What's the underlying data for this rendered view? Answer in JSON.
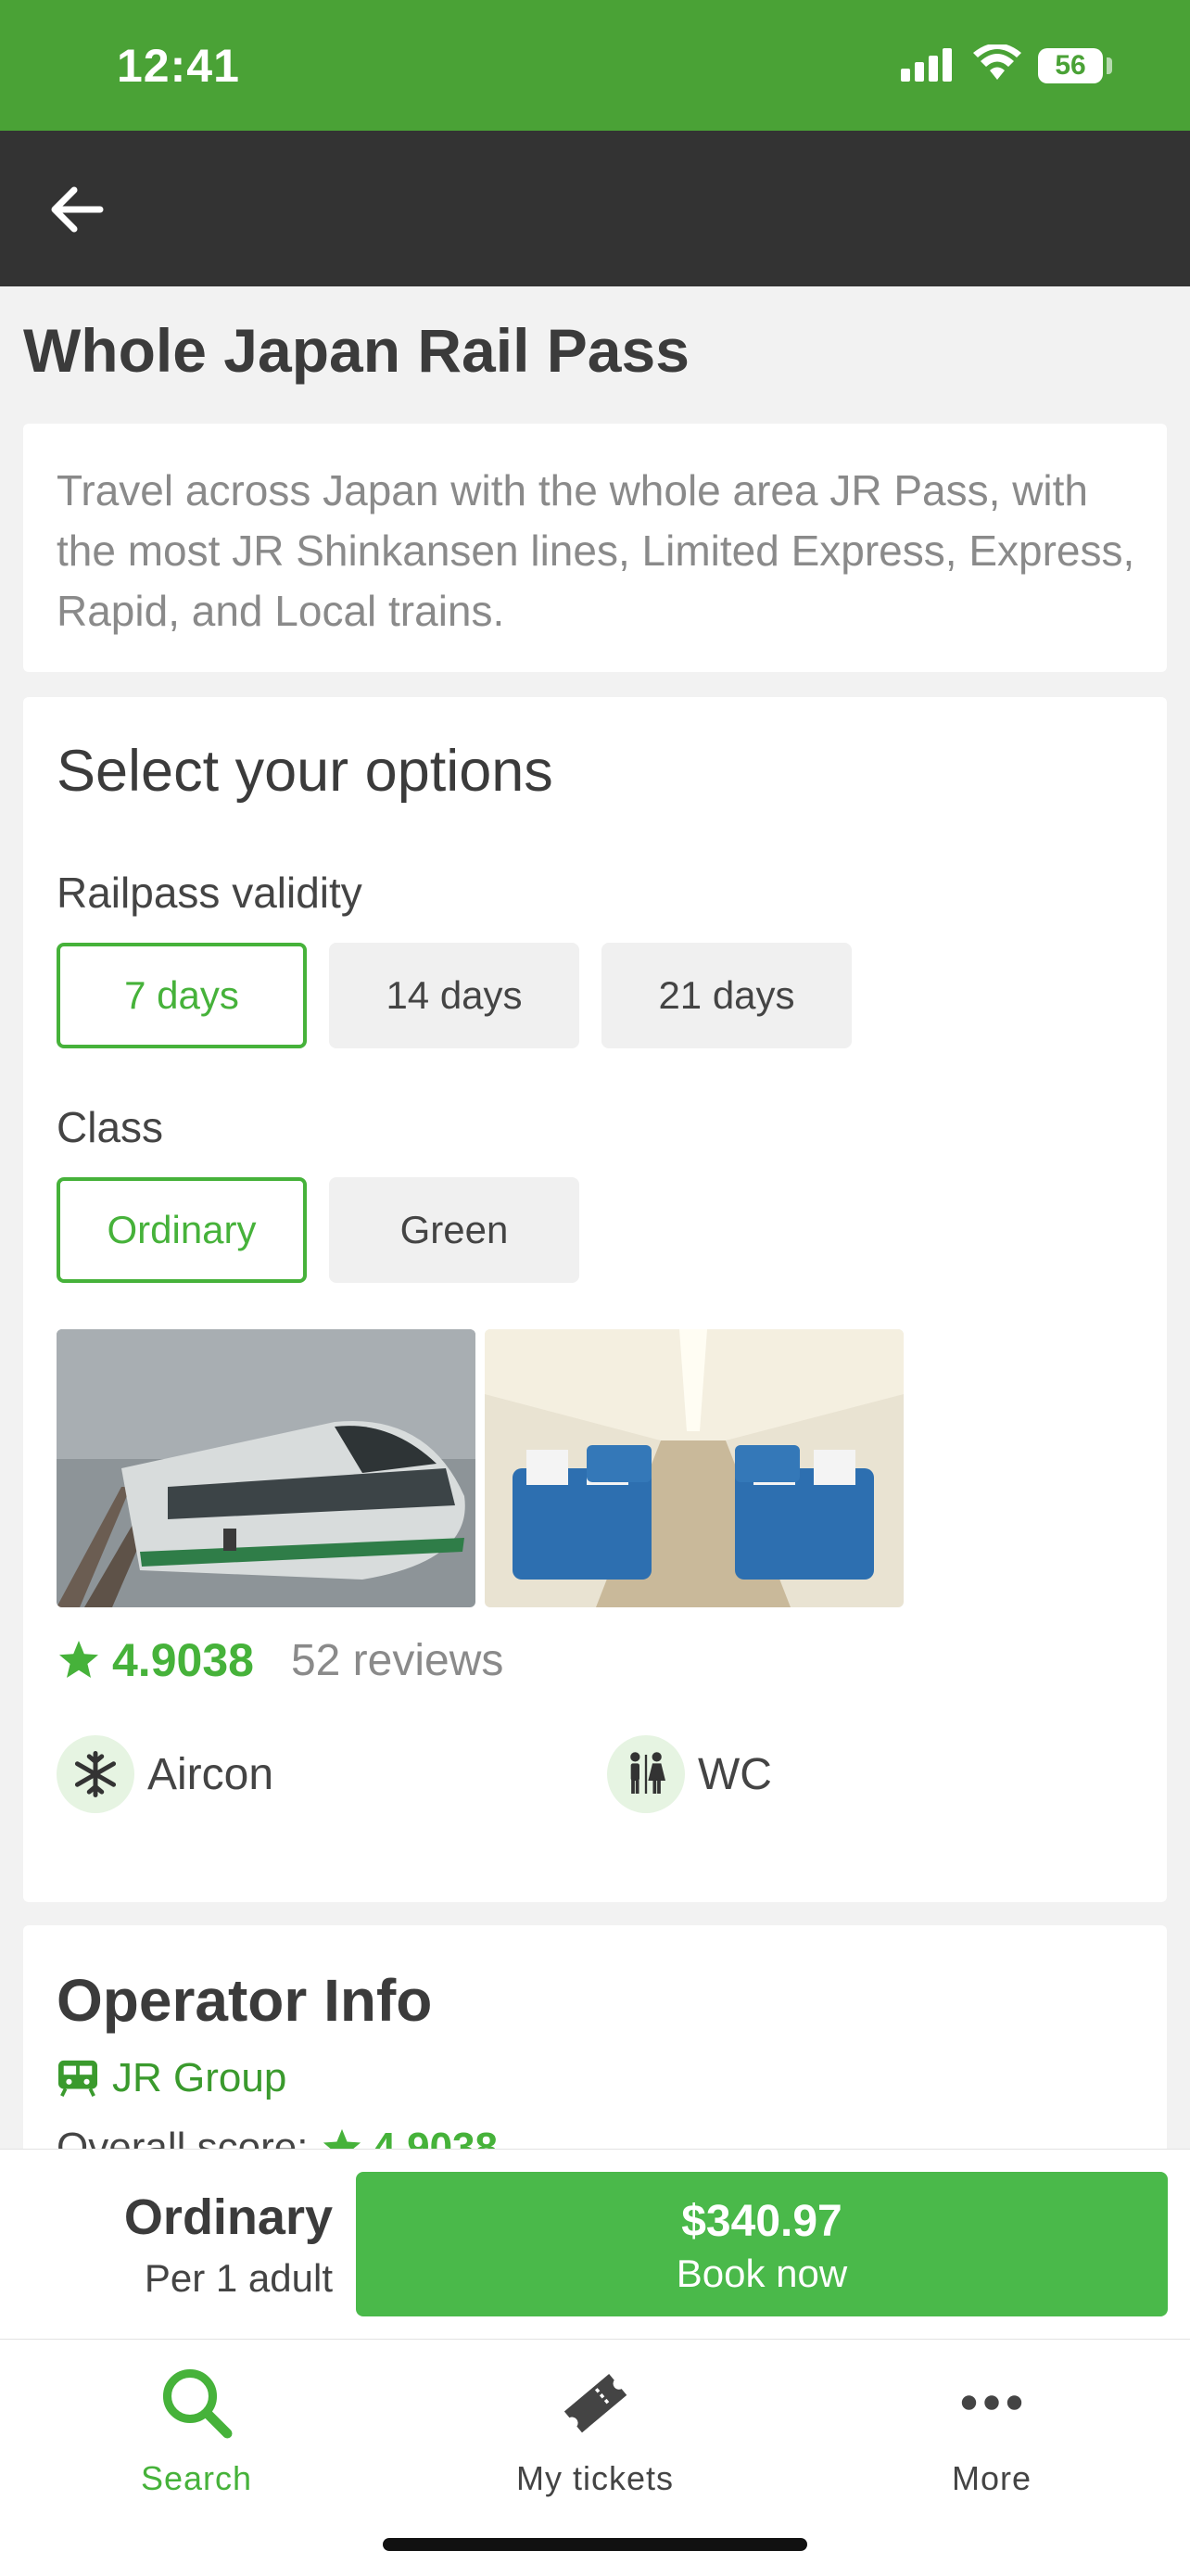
{
  "status_bar": {
    "time": "12:41",
    "battery": "56"
  },
  "page": {
    "title": "Whole Japan Rail Pass",
    "description": "Travel across Japan with the whole area JR Pass, with the most JR Shinkansen lines, Limited Express, Express, Rapid, and Local trains."
  },
  "options": {
    "heading": "Select your options",
    "validity_label": "Railpass validity",
    "validity_options": [
      "7 days",
      "14 days",
      "21 days"
    ],
    "validity_selected": "7 days",
    "class_label": "Class",
    "class_options": [
      "Ordinary",
      "Green"
    ],
    "class_selected": "Ordinary",
    "rating": "4.9038",
    "reviews": "52 reviews",
    "amenities": [
      "Aircon",
      "WC"
    ]
  },
  "operator": {
    "heading": "Operator Info",
    "name": "JR Group",
    "overall_label": "Overall score:",
    "overall_score": "4.9038"
  },
  "booking": {
    "class": "Ordinary",
    "per": "Per 1 adult",
    "price": "$340.97",
    "cta": "Book now"
  },
  "tabs": [
    {
      "label": "Search",
      "icon": "search-icon",
      "active": true
    },
    {
      "label": "My tickets",
      "icon": "ticket-icon",
      "active": false
    },
    {
      "label": "More",
      "icon": "more-icon",
      "active": false
    }
  ],
  "colors": {
    "brand": "#4aa236",
    "accent": "#46b23a",
    "navbar": "#333333"
  }
}
